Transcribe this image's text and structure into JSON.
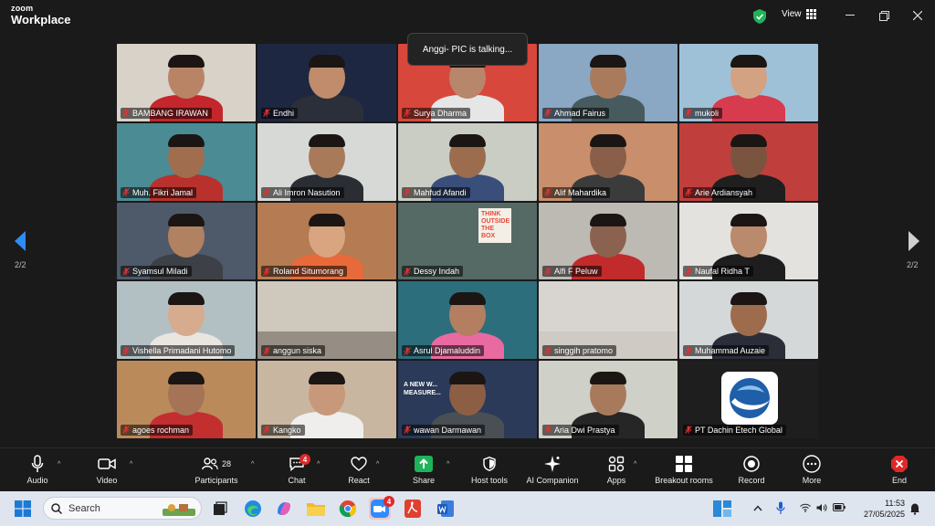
{
  "app": {
    "brand_top": "zoom",
    "brand_bottom": "Workplace",
    "view_label": "View"
  },
  "toast": "Anggi- PIC is talking...",
  "pager": {
    "left": "2/2",
    "right": "2/2"
  },
  "participants": [
    {
      "name": "BAMBANG IRAWAN",
      "bg": "#d9d2c8",
      "skin": "#b98466",
      "shirt": "#c3262b"
    },
    {
      "name": "Endhi",
      "bg": "#1d2742",
      "skin": "#c08c6c",
      "shirt": "#2b2f3a"
    },
    {
      "name": "Surya Dharma",
      "bg": "#d8473b",
      "skin": "#b8866a",
      "shirt": "#e6e6e6"
    },
    {
      "name": "Ahmad Fairus",
      "bg": "#8aa7c4",
      "skin": "#a97a5c",
      "shirt": "#475a5e"
    },
    {
      "name": "mukoli",
      "bg": "#9fc1d8",
      "skin": "#d3a283",
      "shirt": "#d63c4e"
    },
    {
      "name": "Muh. Fikri Jamal",
      "bg": "#4b8b94",
      "skin": "#a06e4e",
      "shirt": "#b8312c"
    },
    {
      "name": "Ali Imron Nasution",
      "bg": "#d7d9d6",
      "skin": "#a87a5a",
      "shirt": "#2a2d33"
    },
    {
      "name": "Mahfud Afandi",
      "bg": "#c9cdc4",
      "skin": "#9b6c4d",
      "shirt": "#3a4e7a"
    },
    {
      "name": "Alif Mahardika",
      "bg": "#c98e6b",
      "skin": "#8a5f4a",
      "shirt": "#3b3b3b"
    },
    {
      "name": "Arie Ardiansyah",
      "bg": "#c03f3d",
      "skin": "#7b5440",
      "shirt": "#1f1f1f"
    },
    {
      "name": "Syamsul Miladi",
      "bg": "#4e5a6a",
      "skin": "#b08262",
      "shirt": "#3d4046"
    },
    {
      "name": "Roland Situmorang",
      "bg": "#b57b52",
      "skin": "#d9a580",
      "shirt": "#e86a3a"
    },
    {
      "name": "Dessy Indah",
      "bg": "#566a65",
      "skin": "#566a65",
      "shirt": "#566a65"
    },
    {
      "name": "Alfi F Peluw",
      "bg": "#bdb9b3",
      "skin": "#8b6250",
      "shirt": "#c12b2b"
    },
    {
      "name": "Naufal Ridha T",
      "bg": "#e4e2de",
      "skin": "#b98a6b",
      "shirt": "#1e1e1e"
    },
    {
      "name": "Vishella Primadani Hutomo",
      "bg": "#b3c0c3",
      "skin": "#d6ab8e",
      "shirt": "#e9e5df"
    },
    {
      "name": "anggun siska",
      "bg": "#cfc8bd",
      "skin": "#cfc8bd",
      "shirt": "#6f665d"
    },
    {
      "name": "Asrul Djamaluddin",
      "bg": "#2d6e7d",
      "skin": "#b37f60",
      "shirt": "#e86aa1"
    },
    {
      "name": "singgih pratomo",
      "bg": "#d8d4cf",
      "skin": "#d8d4cf",
      "shirt": "#c9c3bc"
    },
    {
      "name": "Muhammad Auzaie",
      "bg": "#d5d8d9",
      "skin": "#9c6c4c",
      "shirt": "#2b2e39"
    },
    {
      "name": "agoes rochman",
      "bg": "#bb8a5a",
      "skin": "#a57356",
      "shirt": "#c32f2f"
    },
    {
      "name": "Kangko",
      "bg": "#c9b6a0",
      "skin": "#c8987a",
      "shirt": "#efeeec"
    },
    {
      "name": "wawan Darmawan",
      "bg": "#2a3a58",
      "skin": "#8c5f45",
      "shirt": "#4a4f55"
    },
    {
      "name": "Aria Dwi Prastya",
      "bg": "#cfd0c8",
      "skin": "#a87a5c",
      "shirt": "#262626"
    },
    {
      "name": "PT Dachin Etech Global",
      "bg": "#1e1e1e",
      "skin": "",
      "shirt": ""
    }
  ],
  "tile_overlay_text": {
    "dessy_poster": "THINK OUTSIDE THE BOX",
    "wawan_slide": "A NEW W... MEASURE..."
  },
  "toolbar": {
    "audio": "Audio",
    "video": "Video",
    "participants": "Participants",
    "participants_count": "28",
    "chat": "Chat",
    "chat_badge": "4",
    "react": "React",
    "share": "Share",
    "host_tools": "Host tools",
    "ai_companion": "AI Companion",
    "apps": "Apps",
    "breakout_rooms": "Breakout rooms",
    "record": "Record",
    "more": "More",
    "end": "End"
  },
  "taskbar": {
    "search_placeholder": "Search",
    "zoom_badge": "4",
    "time": "11:53",
    "date": "27/05/2025"
  },
  "colors": {
    "accent_green": "#1fb35a",
    "mute_red": "#e0302f",
    "end_red": "#e02828"
  }
}
